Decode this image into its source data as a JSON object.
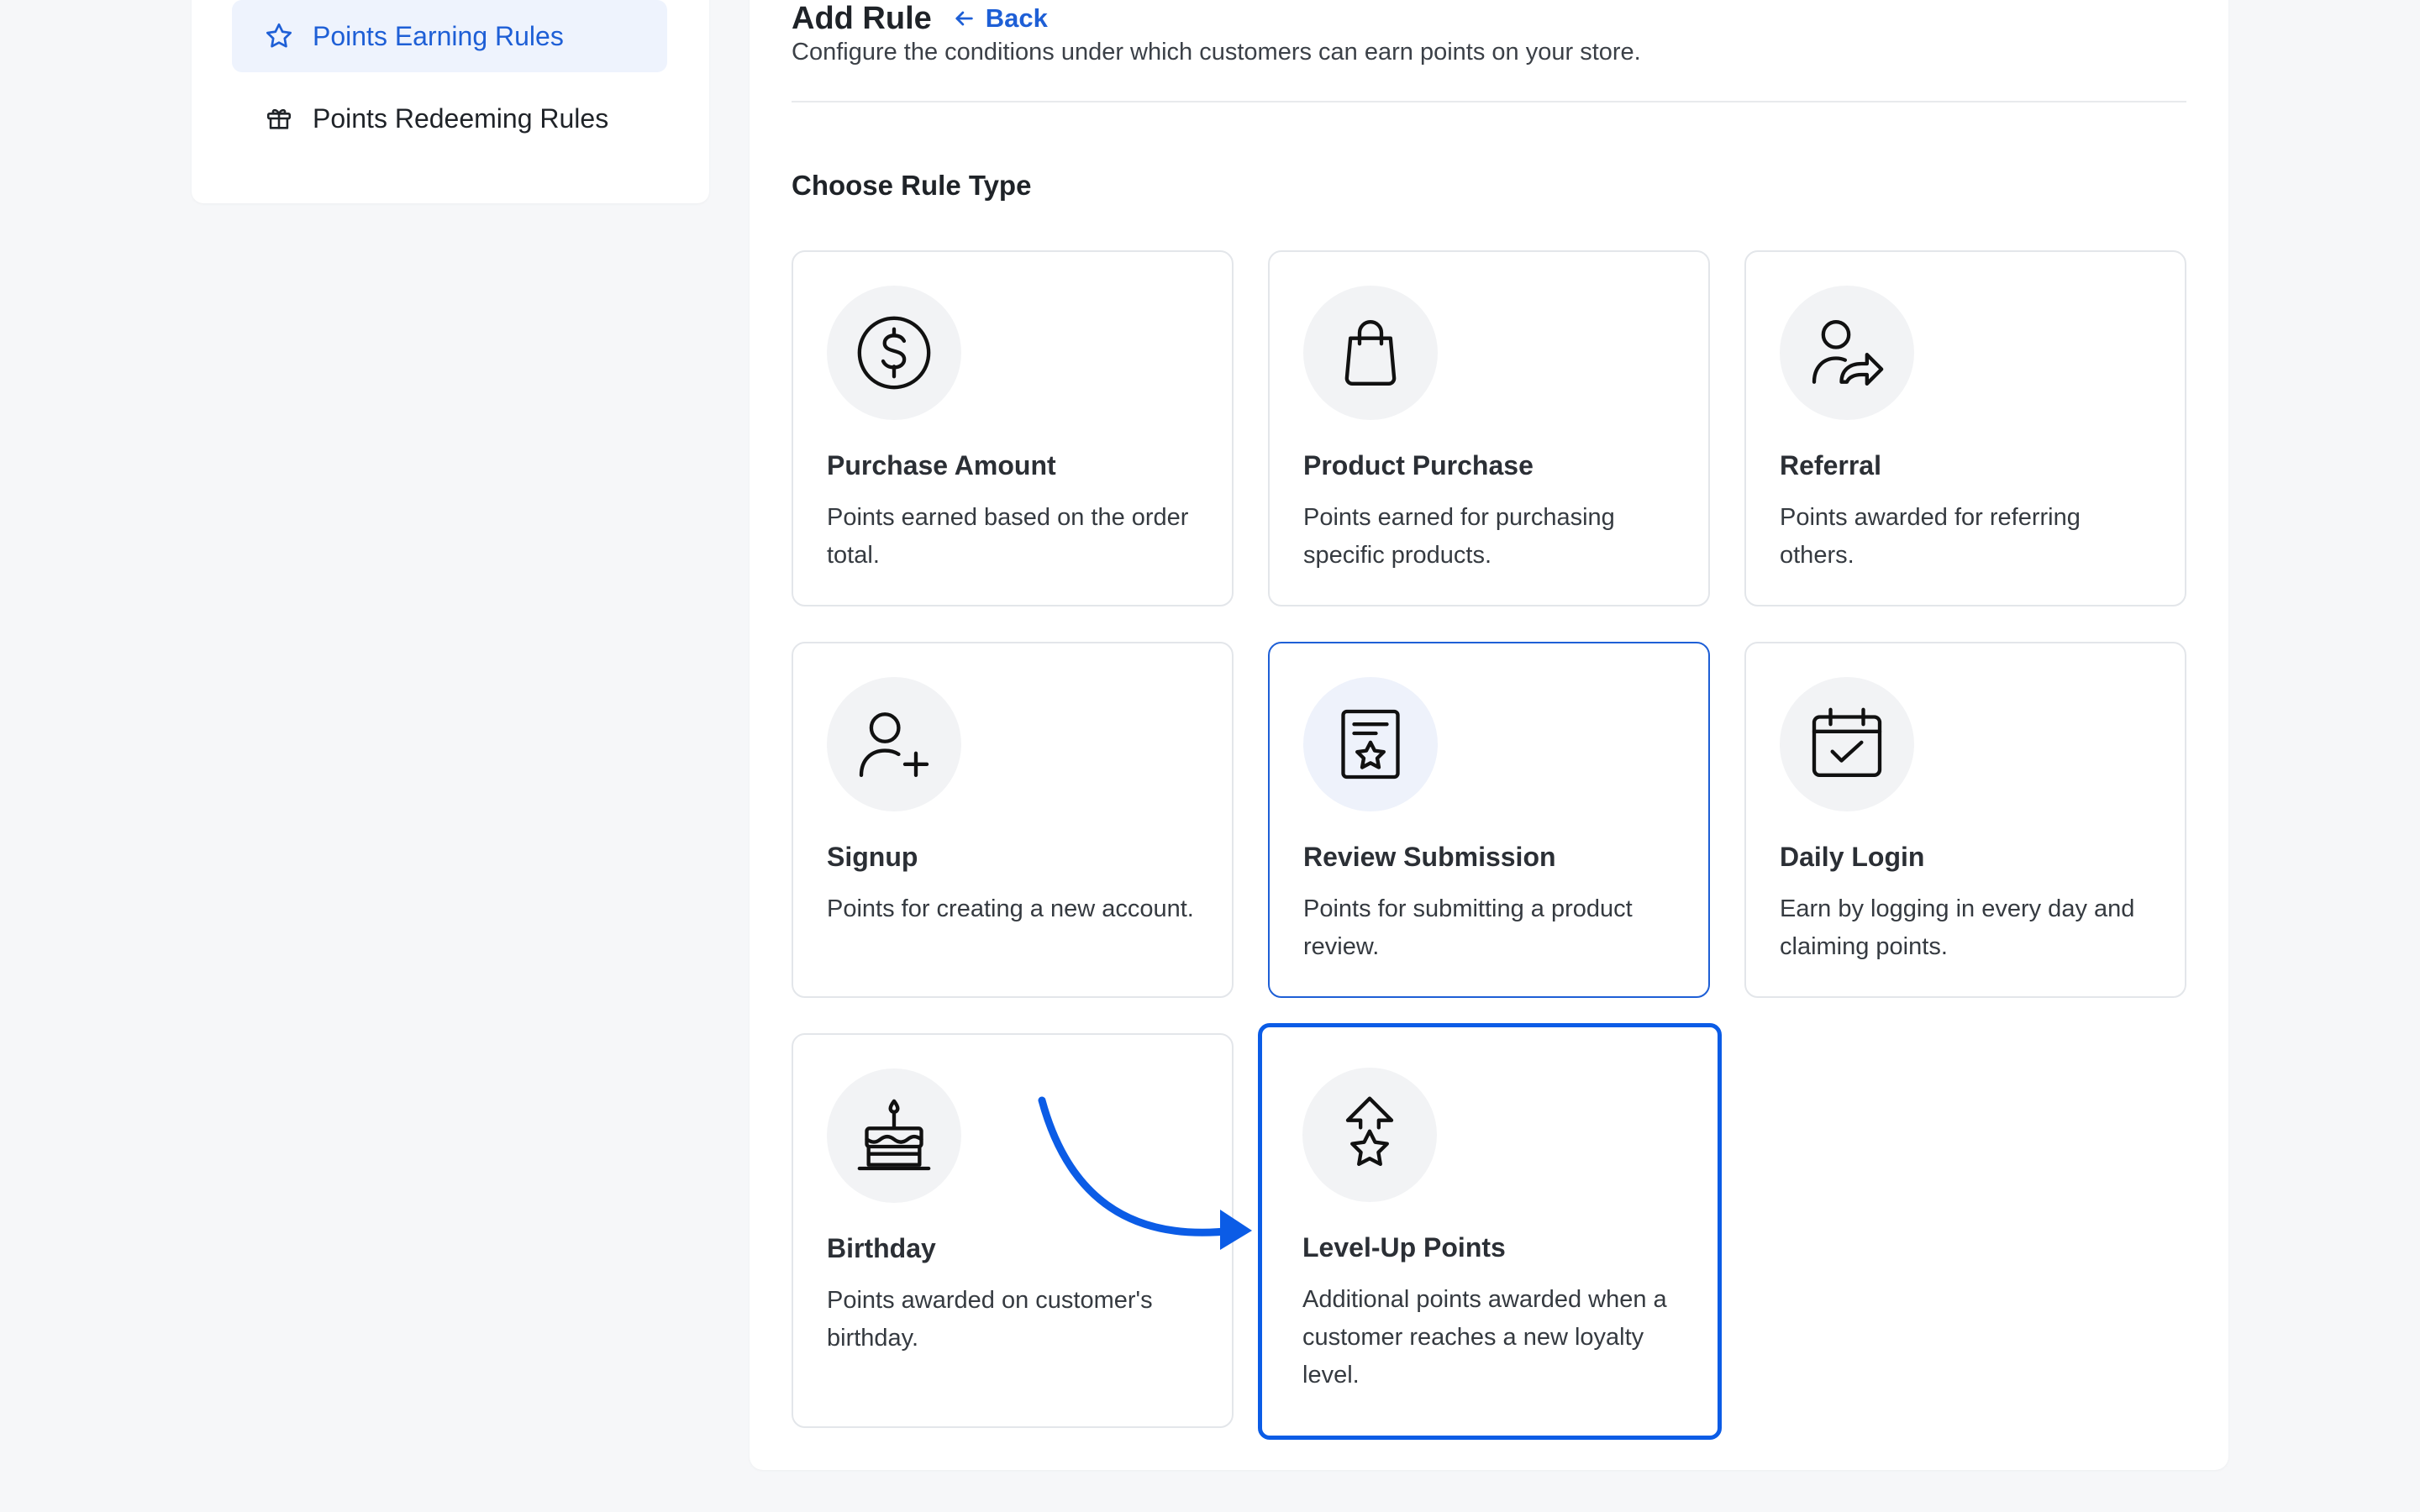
{
  "sidebar": {
    "items": [
      {
        "label": "Points Earning Rules",
        "icon": "star-icon",
        "active": true
      },
      {
        "label": "Points Redeeming Rules",
        "icon": "gift-icon",
        "active": false
      }
    ]
  },
  "header": {
    "title": "Add Rule",
    "back_label": "Back",
    "subtitle": "Configure the conditions under which customers can earn points on your store."
  },
  "section": {
    "title": "Choose Rule Type"
  },
  "rule_types": [
    {
      "title": "Purchase Amount",
      "description": "Points earned based on the order total.",
      "icon": "dollar-circle-icon"
    },
    {
      "title": "Product Purchase",
      "description": "Points earned for purchasing specific products.",
      "icon": "shopping-bag-icon"
    },
    {
      "title": "Referral",
      "description": "Points awarded for referring others.",
      "icon": "user-share-icon"
    },
    {
      "title": "Signup",
      "description": "Points for creating a new account.",
      "icon": "user-plus-icon"
    },
    {
      "title": "Review Submission",
      "description": "Points for submitting a product review.",
      "icon": "review-star-icon"
    },
    {
      "title": "Daily Login",
      "description": "Earn by logging in every day and claiming points.",
      "icon": "calendar-check-icon"
    },
    {
      "title": "Birthday",
      "description": "Points awarded on customer's birthday.",
      "icon": "cake-icon"
    },
    {
      "title": "Level-Up Points",
      "description": "Additional points awarded when a customer reaches a new loyalty level.",
      "icon": "level-up-star-icon"
    }
  ],
  "colors": {
    "accent": "#1e5fd6",
    "selected_border": "#0b5ce6",
    "annotation_arrow": "#0b5ce6"
  }
}
